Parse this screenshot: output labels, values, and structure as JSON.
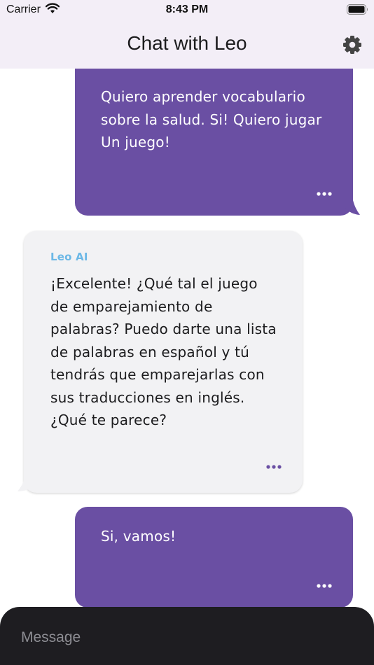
{
  "status_bar": {
    "carrier": "Carrier",
    "time": "8:43 PM",
    "icons": [
      "wifi-icon",
      "battery-icon"
    ]
  },
  "header": {
    "title": "Chat with Leo",
    "settings_icon": "gear-icon"
  },
  "messages": [
    {
      "role": "user",
      "text": "Quiero aprender vocabulario sobre la salud. Si! Quiero jugar Un juego!"
    },
    {
      "role": "assistant",
      "sender": "Leo AI",
      "text": "¡Excelente! ¿Qué tal el juego de emparejamiento de palabras? Puedo darte una lista de palabras en español y tú tendrás que emparejarlas con sus traducciones en inglés. ¿Qué te parece?"
    },
    {
      "role": "user",
      "text": "Si, vamos!"
    }
  ],
  "composer": {
    "placeholder": "Message",
    "value": ""
  },
  "colors": {
    "header_bg": "#f3eef7",
    "user_bubble": "#6a4fa3",
    "bot_bubble": "#f2f2f4",
    "sender_name": "#6cb8e6",
    "composer_bg": "#1e1d21"
  }
}
